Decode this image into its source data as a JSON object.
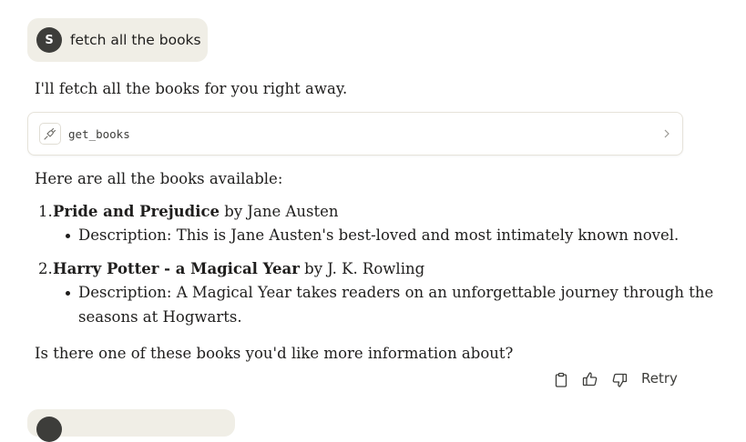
{
  "user_message": {
    "avatar_initial": "S",
    "text": "fetch all the books"
  },
  "assistant": {
    "intro": "I'll fetch all the books for you right away.",
    "tool_call": {
      "name": "get_books",
      "icon": "plug-icon"
    },
    "heading": "Here are all the books available:",
    "books": [
      {
        "number": "1.",
        "title": "Pride and Prejudice",
        "author_text": " by Jane Austen",
        "description_lines": [
          "Description: This is Jane Austen's best-loved and most intimately known novel."
        ]
      },
      {
        "number": "2.",
        "title": "Harry Potter - a Magical Year",
        "author_text": " by J. K. Rowling",
        "description_lines": [
          "Description: A Magical Year takes readers on an unforgettable journey through the",
          "seasons at Hogwarts."
        ]
      }
    ],
    "closing": "Is there one of these books you'd like more information about?"
  },
  "actions": {
    "copy_icon": "clipboard-icon",
    "thumbs_up_icon": "thumbs-up-icon",
    "thumbs_down_icon": "thumbs-down-icon",
    "retry_label": "Retry"
  }
}
